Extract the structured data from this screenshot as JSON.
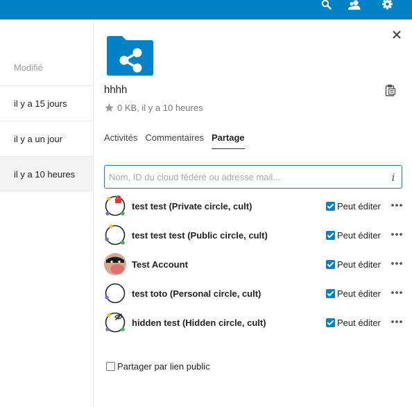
{
  "topbar": {
    "bg_color": "#0082c9",
    "icons": [
      "search-icon",
      "contacts-icon",
      "settings-icon"
    ]
  },
  "file_list": {
    "column_header": "Modifié",
    "rows": [
      {
        "modified": "il y a 15 jours"
      },
      {
        "modified": "il y a un jour"
      },
      {
        "modified": "il y a 10 heures",
        "selected": true
      }
    ]
  },
  "sidebar": {
    "close_icon": "close-icon",
    "thumbnail_icon": "shared-folder-icon",
    "file_name": "hhhh",
    "clipboard_icon": "clipboard-icon",
    "meta_text": "0 KB, il y a 10 heures",
    "tabs": [
      {
        "label": "Activités",
        "active": false
      },
      {
        "label": "Commentaires",
        "active": false
      },
      {
        "label": "Partage",
        "active": true
      }
    ],
    "share_input": {
      "placeholder": "Nom, ID du cloud fédéré ou adresse mail...",
      "value": "",
      "info_label": "i"
    },
    "shares": [
      {
        "name": "test test (Private circle, cult)",
        "avatar": "private-circle-avatar",
        "permission_label": "Peut éditer",
        "can_edit": true
      },
      {
        "name": "test test test (Public circle, cult)",
        "avatar": "public-circle-avatar",
        "permission_label": "Peut éditer",
        "can_edit": true
      },
      {
        "name": "Test Account",
        "avatar": "user-photo-avatar",
        "permission_label": "Peut éditer",
        "can_edit": true
      },
      {
        "name": "test toto (Personal circle, cult)",
        "avatar": "personal-circle-avatar",
        "permission_label": "Peut éditer",
        "can_edit": true
      },
      {
        "name": "hidden test (Hidden circle, cult)",
        "avatar": "hidden-circle-avatar",
        "permission_label": "Peut éditer",
        "can_edit": true
      }
    ],
    "public_link": {
      "label": "Partager par lien public",
      "checked": false
    }
  },
  "colors": {
    "accent": "#0082c9",
    "circle_yellow": "#f4c02f",
    "circle_green": "#49b35c",
    "circle_purple": "#7d74c8",
    "lock_red": "#e9322d"
  }
}
